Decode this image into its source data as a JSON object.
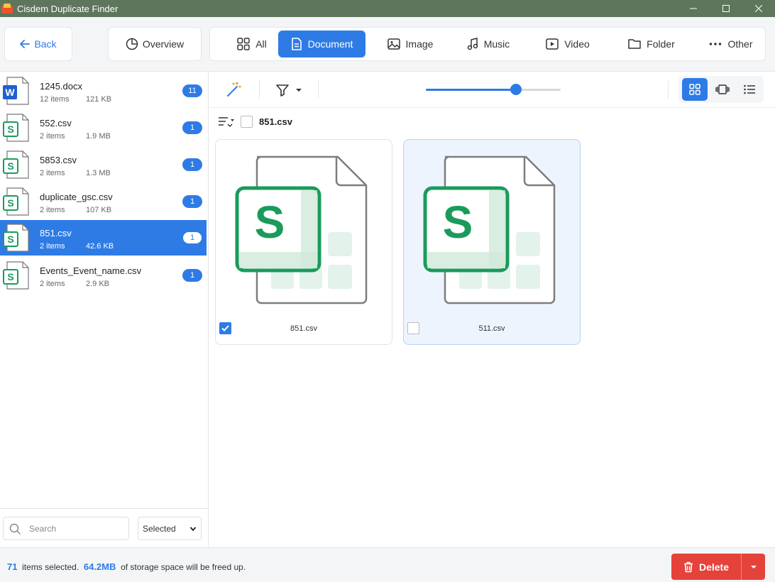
{
  "window": {
    "title": "Cisdem Duplicate Finder"
  },
  "topbar": {
    "back_label": "Back",
    "overview_label": "Overview",
    "tabs": [
      {
        "label": "All",
        "icon": "grid-icon"
      },
      {
        "label": "Document",
        "icon": "document-icon",
        "active": true
      },
      {
        "label": "Image",
        "icon": "image-icon"
      },
      {
        "label": "Music",
        "icon": "music-icon"
      },
      {
        "label": "Video",
        "icon": "video-icon"
      },
      {
        "label": "Folder",
        "icon": "folder-icon"
      },
      {
        "label": "Other",
        "icon": "more-icon"
      }
    ]
  },
  "sidebar": {
    "files": [
      {
        "name": "1245.docx",
        "items": "12 items",
        "size": "121 KB",
        "count": "11",
        "type": "word"
      },
      {
        "name": "552.csv",
        "items": "2 items",
        "size": "1.9 MB",
        "count": "1",
        "type": "sheet"
      },
      {
        "name": "5853.csv",
        "items": "2 items",
        "size": "1.3 MB",
        "count": "1",
        "type": "sheet"
      },
      {
        "name": "duplicate_gsc.csv",
        "items": "2 items",
        "size": "107 KB",
        "count": "1",
        "type": "sheet"
      },
      {
        "name": "851.csv",
        "items": "2 items",
        "size": "42.6 KB",
        "count": "1",
        "type": "sheet",
        "selected": true
      },
      {
        "name": "Events_Event_name.csv",
        "items": "2 items",
        "size": "2.9 KB",
        "count": "1",
        "type": "sheet"
      }
    ],
    "search_placeholder": "Search",
    "filter_value": "Selected"
  },
  "main": {
    "group_title": "851.csv",
    "zoom_fraction": 0.67,
    "cards": [
      {
        "name": "851.csv",
        "checked": true
      },
      {
        "name": "511.csv",
        "checked": false
      }
    ]
  },
  "bottombar": {
    "selected_count": "71",
    "selected_text": "items selected.",
    "size": "64.2MB",
    "size_text": "of storage space will be freed up.",
    "delete_label": "Delete"
  },
  "colors": {
    "accent": "#2e7be6",
    "titlebar": "#5e765c",
    "delete": "#e5423a",
    "sheet_green": "#1a9b5b"
  }
}
